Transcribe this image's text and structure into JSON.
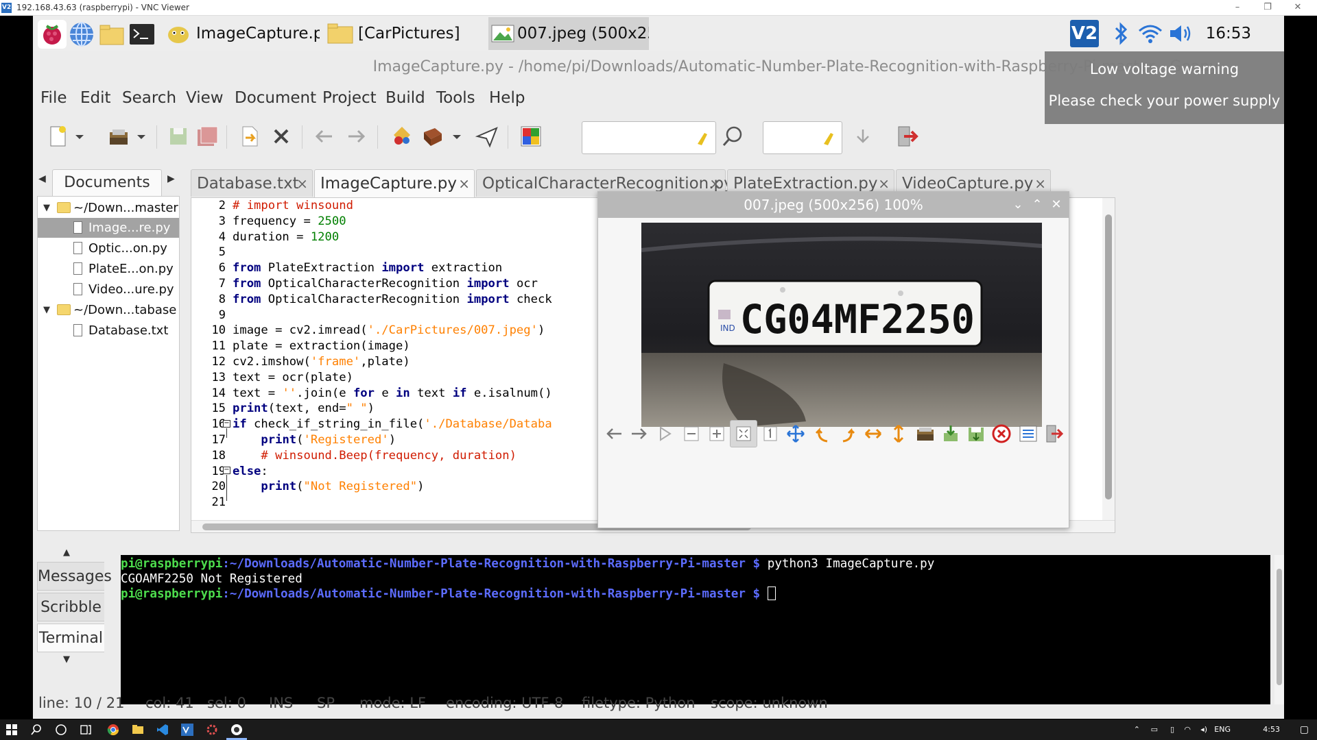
{
  "vnc": {
    "title": "192.168.43.63 (raspberrypi) - VNC Viewer",
    "logo": "V2"
  },
  "panel": {
    "tasks": [
      {
        "label": "ImageCapture.py - /h..."
      },
      {
        "label": "[CarPictures]"
      },
      {
        "label": "007.jpeg (500x256) 1..."
      }
    ],
    "clock": "16:53",
    "vnc_tray": "V2"
  },
  "app": {
    "title": "ImageCapture.py - /home/pi/Downloads/Automatic-Number-Plate-Recognition-with-Raspberry-Pi-master - Geany"
  },
  "menu": [
    "File",
    "Edit",
    "Search",
    "View",
    "Document",
    "Project",
    "Build",
    "Tools",
    "Help"
  ],
  "sidebar": {
    "tab": "Documents",
    "tree": [
      {
        "label": "~/Down...master",
        "type": "folder",
        "level": 0
      },
      {
        "label": "Image...re.py",
        "type": "file",
        "level": 1,
        "selected": true
      },
      {
        "label": "Optic...on.py",
        "type": "file",
        "level": 1
      },
      {
        "label": "PlateE...on.py",
        "type": "file",
        "level": 1
      },
      {
        "label": "Video...ure.py",
        "type": "file",
        "level": 1
      },
      {
        "label": "~/Down...tabase",
        "type": "folder",
        "level": 0
      },
      {
        "label": "Database.txt",
        "type": "file",
        "level": 1
      }
    ]
  },
  "tabs": [
    {
      "label": "Database.txt"
    },
    {
      "label": "ImageCapture.py",
      "active": true
    },
    {
      "label": "OpticalCharacterRecognition.py"
    },
    {
      "label": "PlateExtraction.py"
    },
    {
      "label": "VideoCapture.py"
    }
  ],
  "tab_close": "×",
  "editor": {
    "line_numbers": [
      "2",
      "3",
      "4",
      "5",
      "6",
      "7",
      "8",
      "9",
      "10",
      "11",
      "12",
      "13",
      "14",
      "15",
      "16",
      "17",
      "18",
      "19",
      "20",
      "21"
    ]
  },
  "viewer": {
    "title": "007.jpeg (500x256) 100%",
    "plate_text": "CG04MF2250",
    "plate_country": "IND"
  },
  "messages": {
    "tabs": [
      "Messages",
      "Scribble",
      "Terminal"
    ],
    "terminal": {
      "prompt_user": "pi@raspberrypi",
      "prompt_path": ":~/Downloads/Automatic-Number-Plate-Recognition-with-Raspberry-Pi-master $",
      "command": " python3 ImageCapture.py",
      "output": "CGOAMF2250 Not Registered"
    }
  },
  "status": {
    "line": "line: 10 / 21",
    "col": "col: 41",
    "sel": "sel: 0",
    "ins": "INS",
    "sp": "SP",
    "mode": "mode: LF",
    "encoding": "encoding: UTF-8",
    "filetype": "filetype: Python",
    "scope": "scope: unknown"
  },
  "notification": {
    "title": "Low voltage warning",
    "body": "Please check your power supply"
  },
  "host_taskbar": {
    "lang": "ENG",
    "time": "4:53 PM"
  }
}
